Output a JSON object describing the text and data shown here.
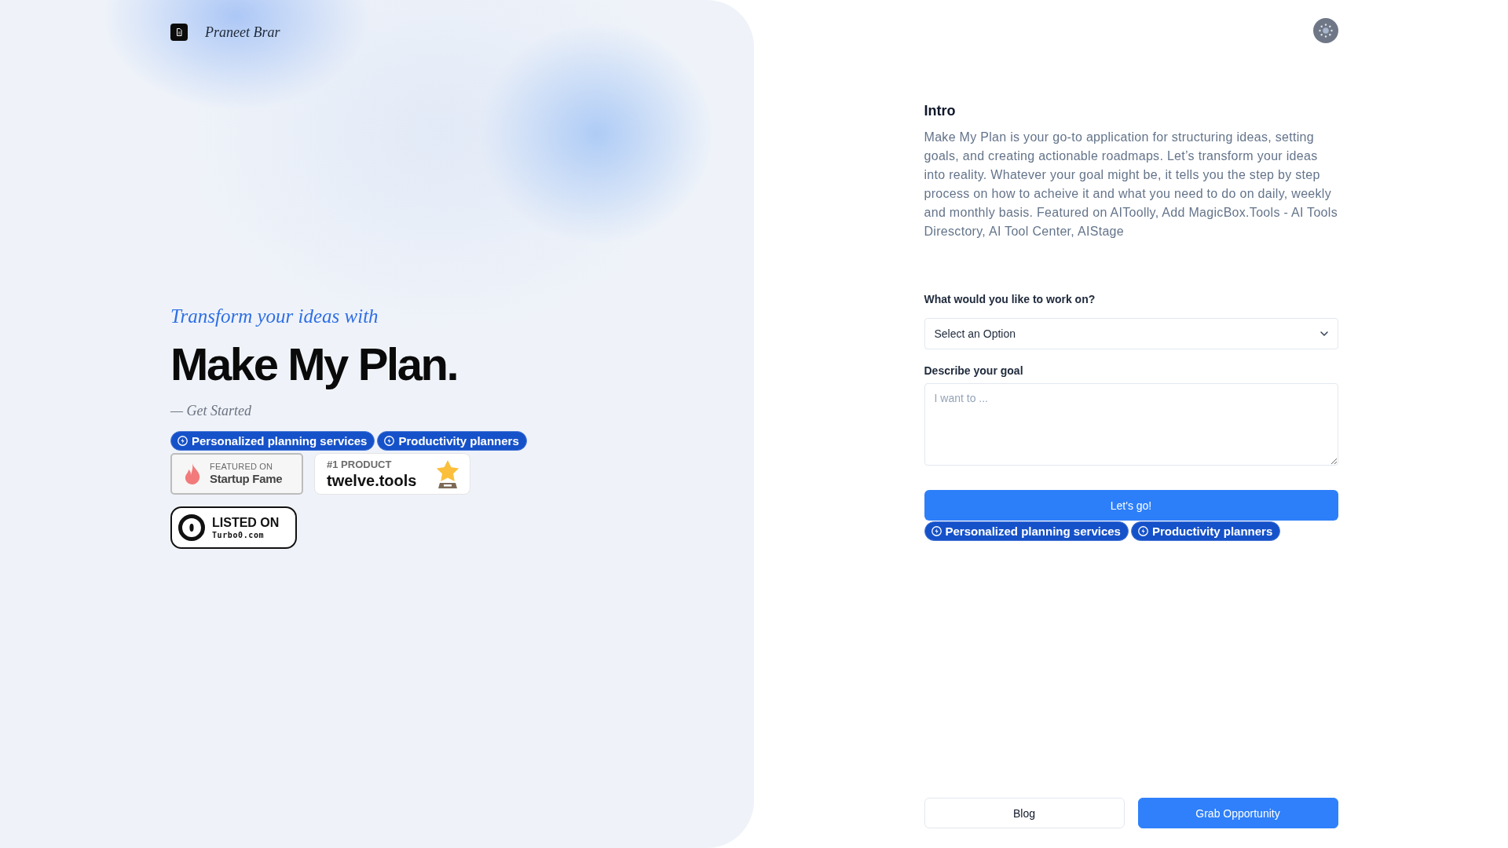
{
  "header": {
    "brand": "Praneet Brar"
  },
  "hero": {
    "tagline": "Transform your ideas with",
    "title": "Make My Plan.",
    "cta": "— Get Started",
    "chips": [
      "Personalized planning services",
      "Productivity planners"
    ],
    "badges": [
      {
        "kind": "startup_fame",
        "caption": "FEATURED ON",
        "name": "Startup Fame"
      },
      {
        "kind": "twelve_tools",
        "caption": "#1 PRODUCT",
        "name": "twelve.tools"
      },
      {
        "kind": "turbo0",
        "caption": "LISTED ON",
        "name": "Turbo0.com"
      }
    ]
  },
  "intro": {
    "title": "Intro",
    "text": "Make My Plan is your go-to application for structuring ideas, setting goals, and creating actionable roadmaps. Let’s transform your ideas into reality. Whatever your goal might be, it tells you the step by step process on how to acheive it and what you need to do on daily, weekly and monthly basis. Featured on AIToolly, Add MagicBox.Tools - AI Tools Diresctory, AI Tool Center, AIStage"
  },
  "form": {
    "fields": [
      {
        "kind": "select",
        "label": "What would you like to work on?",
        "value": "Select an Option"
      },
      {
        "kind": "textarea",
        "label": "Describe your goal",
        "placeholder": "I want to ..."
      }
    ],
    "submit": "Let's go!",
    "chips": [
      "Personalized planning services",
      "Productivity planners"
    ]
  },
  "footer_buttons": [
    {
      "kind": "secondary",
      "label": "Blog"
    },
    {
      "kind": "primary",
      "label": "Grab Opportunity"
    }
  ]
}
